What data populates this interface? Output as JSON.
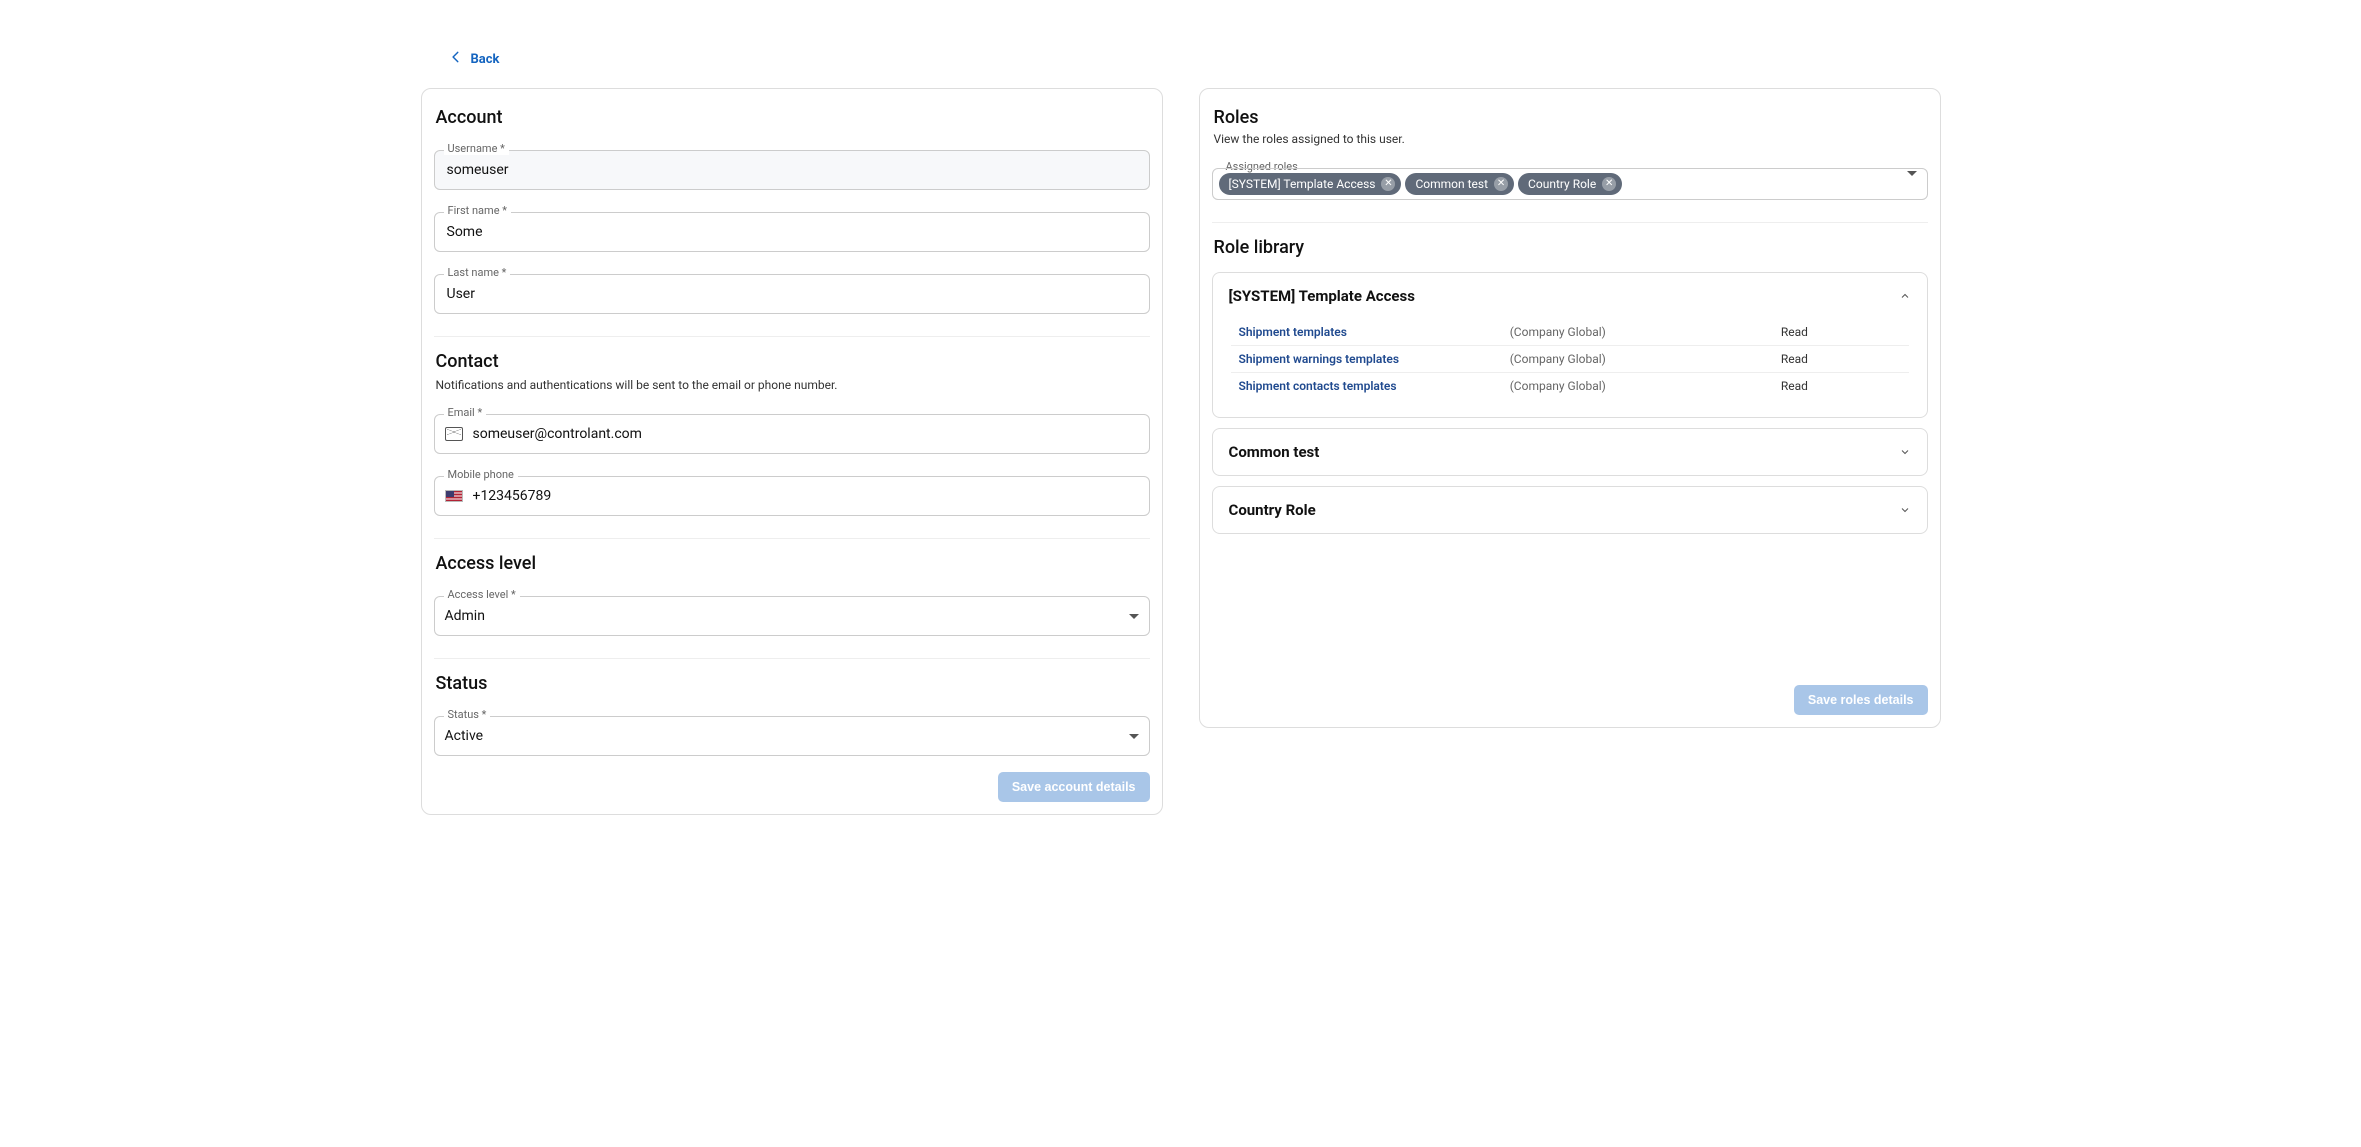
{
  "nav": {
    "back": "Back"
  },
  "account": {
    "heading": "Account",
    "username_label": "Username *",
    "username": "someuser",
    "firstname_label": "First name *",
    "firstname": "Some",
    "lastname_label": "Last name *",
    "lastname": "User"
  },
  "contact": {
    "heading": "Contact",
    "subtext": "Notifications and authentications will be sent to the email or phone number.",
    "email_label": "Email *",
    "email": "someuser@controlant.com",
    "phone_label": "Mobile phone",
    "phone": "+123456789"
  },
  "access": {
    "heading": "Access level",
    "label": "Access level *",
    "value": "Admin"
  },
  "status": {
    "heading": "Status",
    "label": "Status *",
    "value": "Active"
  },
  "buttons": {
    "save_account": "Save account details",
    "save_roles": "Save roles details"
  },
  "roles": {
    "heading": "Roles",
    "subtext": "View the roles assigned to this user.",
    "assigned_label": "Assigned roles",
    "chips": [
      "[SYSTEM] Template Access",
      "Common test",
      "Country Role"
    ],
    "library_heading": "Role library",
    "library": [
      {
        "name": "[SYSTEM] Template Access",
        "expanded": true,
        "permissions": [
          {
            "name": "Shipment templates",
            "scope": "(Company Global)",
            "level": "Read"
          },
          {
            "name": "Shipment warnings templates",
            "scope": "(Company Global)",
            "level": "Read"
          },
          {
            "name": "Shipment contacts templates",
            "scope": "(Company Global)",
            "level": "Read"
          }
        ]
      },
      {
        "name": "Common test",
        "expanded": false,
        "permissions": []
      },
      {
        "name": "Country Role",
        "expanded": false,
        "permissions": []
      }
    ]
  }
}
